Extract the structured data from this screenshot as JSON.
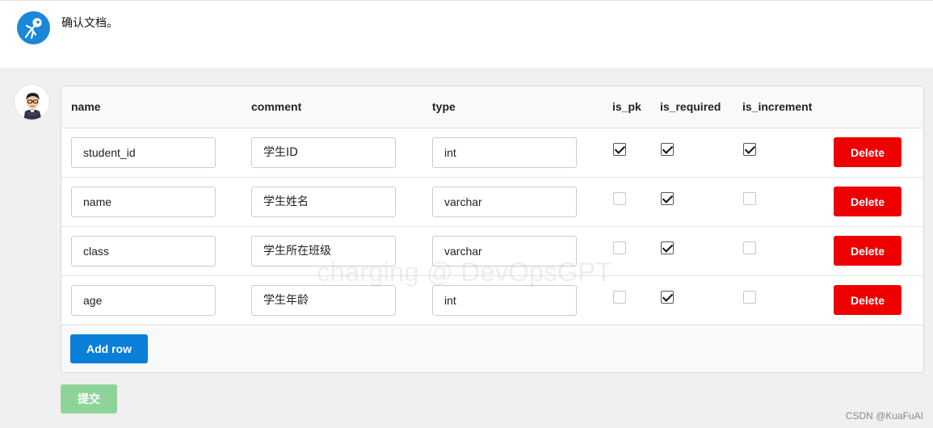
{
  "chat": {
    "bot_message": "确认文档。"
  },
  "table": {
    "headers": {
      "name": "name",
      "comment": "comment",
      "type": "type",
      "is_pk": "is_pk",
      "is_required": "is_required",
      "is_increment": "is_increment"
    },
    "rows": [
      {
        "name": "student_id",
        "comment": "学生ID",
        "type": "int",
        "is_pk": true,
        "is_required": true,
        "is_increment": true,
        "delete_label": "Delete"
      },
      {
        "name": "name",
        "comment": "学生姓名",
        "type": "varchar",
        "is_pk": false,
        "is_required": true,
        "is_increment": false,
        "delete_label": "Delete"
      },
      {
        "name": "class",
        "comment": "学生所在班级",
        "type": "varchar",
        "is_pk": false,
        "is_required": true,
        "is_increment": false,
        "delete_label": "Delete"
      },
      {
        "name": "age",
        "comment": "学生年龄",
        "type": "int",
        "is_pk": false,
        "is_required": true,
        "is_increment": false,
        "delete_label": "Delete"
      }
    ],
    "add_row_label": "Add row"
  },
  "submit_label": "提交",
  "watermark": "charging @ DevOpsGPT",
  "credit": "CSDN @KuaFuAI",
  "colors": {
    "bot_avatar": "#1b87d8",
    "delete_button": "#ee0000",
    "add_button": "#0a7fd9",
    "submit_button_disabled": "#8ed49a",
    "page_background": "#f0f0f0"
  },
  "icons": {
    "bot_avatar": "astronaut-icon",
    "user_avatar": "user-avatar-illustration"
  }
}
